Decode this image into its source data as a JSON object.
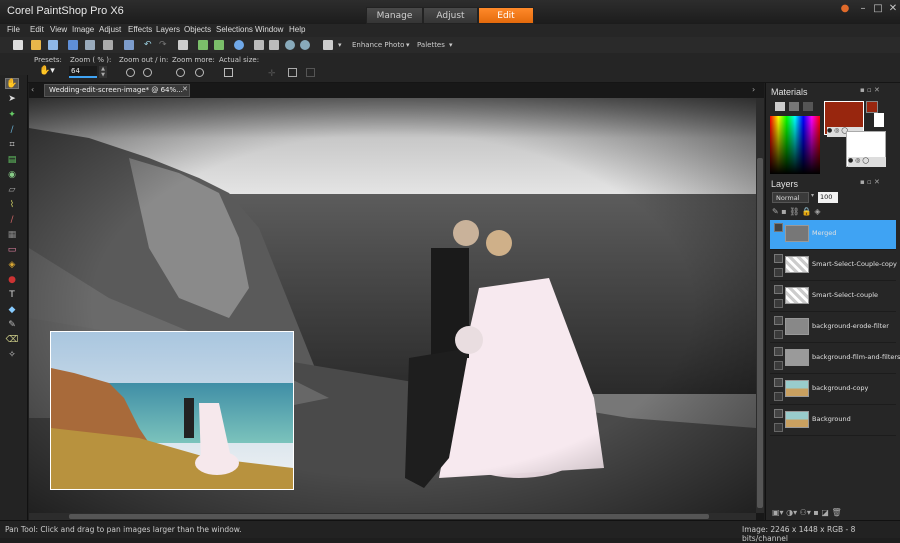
{
  "app": {
    "title": "Corel PaintShop Pro X6"
  },
  "modes": [
    {
      "label": "Manage",
      "active": false
    },
    {
      "label": "Adjust",
      "active": false
    },
    {
      "label": "Edit",
      "active": true
    }
  ],
  "menu": [
    "File",
    "Edit",
    "View",
    "Image",
    "Adjust",
    "Effects",
    "Layers",
    "Objects",
    "Selections",
    "Window",
    "Help"
  ],
  "toolbar": {
    "enhance_photo": "Enhance Photo",
    "palettes": "Palettes"
  },
  "options": {
    "presets_label": "Presets:",
    "zoom_label": "Zoom ( % ):",
    "zoom_value": "64",
    "zoom_out_in_label": "Zoom out / in:",
    "zoom_more_label": "Zoom more:",
    "actual_size_label": "Actual size:"
  },
  "document": {
    "tab_title": "Wedding-edit-screen-image*   @   64%..."
  },
  "materials": {
    "title": "Materials",
    "foreground_color": "#98260e",
    "background_color": "#ffffff"
  },
  "layers": {
    "title": "Layers",
    "blend_mode": "Normal",
    "opacity": "100",
    "items": [
      {
        "name": "Merged",
        "selected": true
      },
      {
        "name": "Smart-Select-Couple-copy",
        "selected": false
      },
      {
        "name": "Smart-Select-couple",
        "selected": false
      },
      {
        "name": "background-erode-filter",
        "selected": false
      },
      {
        "name": "background-film-and-filters",
        "selected": false
      },
      {
        "name": "background-copy",
        "selected": false
      },
      {
        "name": "Background",
        "selected": false
      }
    ]
  },
  "status": {
    "hint": "Pan Tool: Click and drag to pan images larger than the window.",
    "image_info": "Image:  2246 x 1448 x RGB - 8 bits/channel"
  },
  "colors": {
    "accent": "#f07a1c",
    "selection": "#3fa3f3"
  }
}
